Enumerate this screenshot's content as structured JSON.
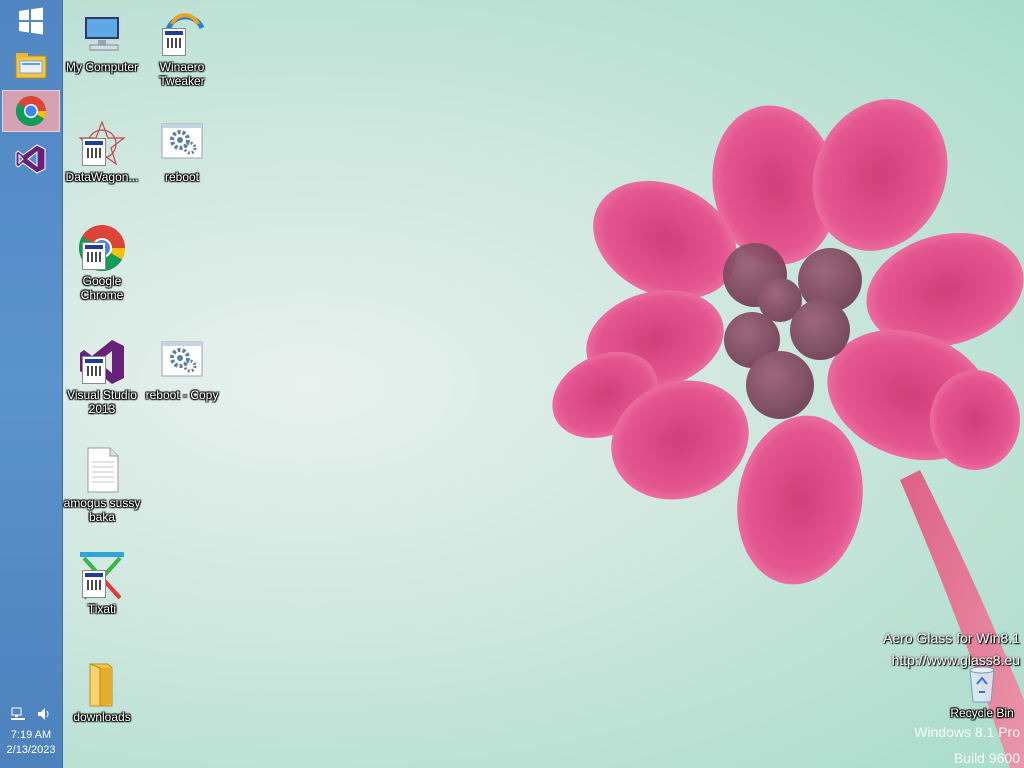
{
  "taskbar": {
    "pinned": [
      {
        "icon": "windows-start-icon"
      },
      {
        "icon": "file-explorer-icon"
      },
      {
        "icon": "chrome-icon",
        "active": true
      },
      {
        "icon": "visual-studio-icon"
      }
    ],
    "tray": {
      "icons": [
        "network-icon",
        "volume-icon"
      ],
      "time": "7:19 AM",
      "date": "2/13/2023"
    }
  },
  "desktop": {
    "icons": {
      "my_computer": "My Computer",
      "winaero": "Winaero Tweaker",
      "datawagon": "DataWagon...",
      "reboot": "reboot",
      "chrome": "Google Chrome",
      "visual_studio": "Visual Studio 2013",
      "reboot_copy": "reboot - Copy",
      "amogus": "amogus sussy baka",
      "tixati": "Tixati",
      "downloads": "downloads",
      "recycle_bin": "Recycle Bin"
    }
  },
  "watermark": {
    "aero_line1": "Aero Glass for Win8.1",
    "aero_line2": "http://www.glass8.eu",
    "os": "Windows 8.1 Pro",
    "build": "Build 9600"
  },
  "colors": {
    "taskbar": "#5b93cc",
    "flower": "#e0407e",
    "background": "#cfe7df"
  }
}
